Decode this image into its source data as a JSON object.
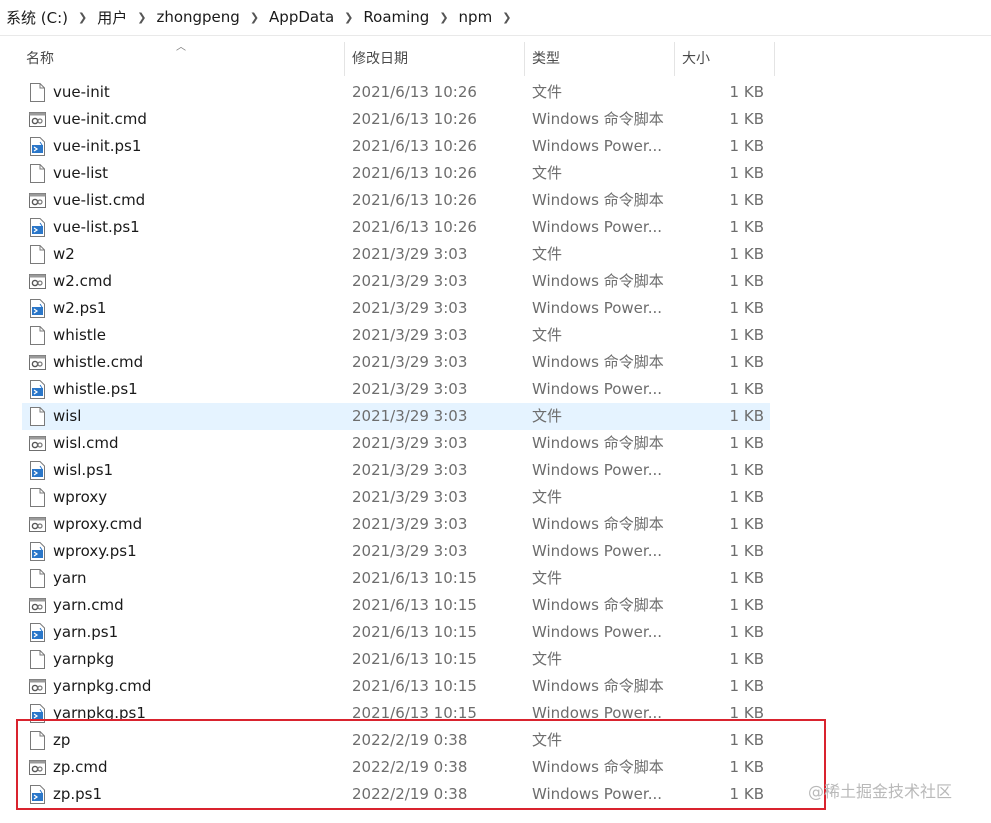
{
  "breadcrumb": [
    "系统 (C:)",
    "用户",
    "zhongpeng",
    "AppData",
    "Roaming",
    "npm"
  ],
  "columns": {
    "name": "名称",
    "date": "修改日期",
    "type": "类型",
    "size": "大小"
  },
  "files": [
    {
      "name": "vue-init",
      "date": "2021/6/13 10:26",
      "type": "文件",
      "size": "1 KB",
      "icon": "file-icon"
    },
    {
      "name": "vue-init.cmd",
      "date": "2021/6/13 10:26",
      "type": "Windows 命令脚本",
      "size": "1 KB",
      "icon": "cmd-script-icon"
    },
    {
      "name": "vue-init.ps1",
      "date": "2021/6/13 10:26",
      "type": "Windows Power...",
      "size": "1 KB",
      "icon": "powershell-script-icon"
    },
    {
      "name": "vue-list",
      "date": "2021/6/13 10:26",
      "type": "文件",
      "size": "1 KB",
      "icon": "file-icon"
    },
    {
      "name": "vue-list.cmd",
      "date": "2021/6/13 10:26",
      "type": "Windows 命令脚本",
      "size": "1 KB",
      "icon": "cmd-script-icon"
    },
    {
      "name": "vue-list.ps1",
      "date": "2021/6/13 10:26",
      "type": "Windows Power...",
      "size": "1 KB",
      "icon": "powershell-script-icon"
    },
    {
      "name": "w2",
      "date": "2021/3/29 3:03",
      "type": "文件",
      "size": "1 KB",
      "icon": "file-icon"
    },
    {
      "name": "w2.cmd",
      "date": "2021/3/29 3:03",
      "type": "Windows 命令脚本",
      "size": "1 KB",
      "icon": "cmd-script-icon"
    },
    {
      "name": "w2.ps1",
      "date": "2021/3/29 3:03",
      "type": "Windows Power...",
      "size": "1 KB",
      "icon": "powershell-script-icon"
    },
    {
      "name": "whistle",
      "date": "2021/3/29 3:03",
      "type": "文件",
      "size": "1 KB",
      "icon": "file-icon"
    },
    {
      "name": "whistle.cmd",
      "date": "2021/3/29 3:03",
      "type": "Windows 命令脚本",
      "size": "1 KB",
      "icon": "cmd-script-icon"
    },
    {
      "name": "whistle.ps1",
      "date": "2021/3/29 3:03",
      "type": "Windows Power...",
      "size": "1 KB",
      "icon": "powershell-script-icon"
    },
    {
      "name": "wisl",
      "date": "2021/3/29 3:03",
      "type": "文件",
      "size": "1 KB",
      "icon": "file-icon",
      "hover": true
    },
    {
      "name": "wisl.cmd",
      "date": "2021/3/29 3:03",
      "type": "Windows 命令脚本",
      "size": "1 KB",
      "icon": "cmd-script-icon"
    },
    {
      "name": "wisl.ps1",
      "date": "2021/3/29 3:03",
      "type": "Windows Power...",
      "size": "1 KB",
      "icon": "powershell-script-icon"
    },
    {
      "name": "wproxy",
      "date": "2021/3/29 3:03",
      "type": "文件",
      "size": "1 KB",
      "icon": "file-icon"
    },
    {
      "name": "wproxy.cmd",
      "date": "2021/3/29 3:03",
      "type": "Windows 命令脚本",
      "size": "1 KB",
      "icon": "cmd-script-icon"
    },
    {
      "name": "wproxy.ps1",
      "date": "2021/3/29 3:03",
      "type": "Windows Power...",
      "size": "1 KB",
      "icon": "powershell-script-icon"
    },
    {
      "name": "yarn",
      "date": "2021/6/13 10:15",
      "type": "文件",
      "size": "1 KB",
      "icon": "file-icon"
    },
    {
      "name": "yarn.cmd",
      "date": "2021/6/13 10:15",
      "type": "Windows 命令脚本",
      "size": "1 KB",
      "icon": "cmd-script-icon"
    },
    {
      "name": "yarn.ps1",
      "date": "2021/6/13 10:15",
      "type": "Windows Power...",
      "size": "1 KB",
      "icon": "powershell-script-icon"
    },
    {
      "name": "yarnpkg",
      "date": "2021/6/13 10:15",
      "type": "文件",
      "size": "1 KB",
      "icon": "file-icon"
    },
    {
      "name": "yarnpkg.cmd",
      "date": "2021/6/13 10:15",
      "type": "Windows 命令脚本",
      "size": "1 KB",
      "icon": "cmd-script-icon"
    },
    {
      "name": "yarnpkg.ps1",
      "date": "2021/6/13 10:15",
      "type": "Windows Power...",
      "size": "1 KB",
      "icon": "powershell-script-icon"
    },
    {
      "name": "zp",
      "date": "2022/2/19 0:38",
      "type": "文件",
      "size": "1 KB",
      "icon": "file-icon"
    },
    {
      "name": "zp.cmd",
      "date": "2022/2/19 0:38",
      "type": "Windows 命令脚本",
      "size": "1 KB",
      "icon": "cmd-script-icon"
    },
    {
      "name": "zp.ps1",
      "date": "2022/2/19 0:38",
      "type": "Windows Power...",
      "size": "1 KB",
      "icon": "powershell-script-icon"
    }
  ],
  "watermark": "@稀土掘金技术社区",
  "colors": {
    "hover_row": "#e5f3ff",
    "annotation_box": "#d9232e"
  }
}
